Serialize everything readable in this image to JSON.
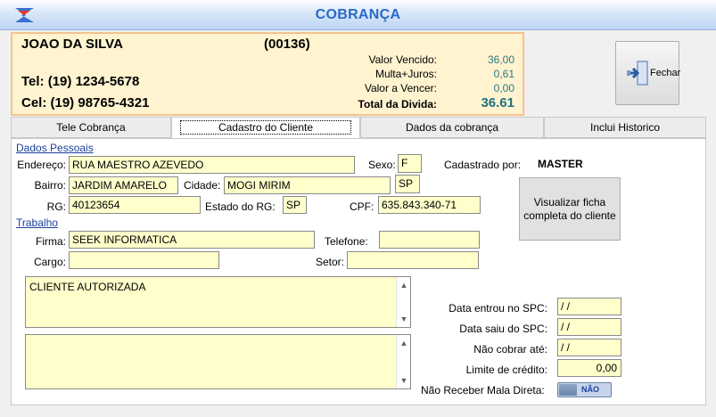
{
  "window": {
    "title": "COBRANÇA"
  },
  "summary": {
    "name": "JOAO DA SILVA",
    "code": "(00136)",
    "tel": "Tel: (19) 1234-5678",
    "cel": "Cel: (19) 98765-4321",
    "valor_vencido_label": "Valor Vencido:",
    "valor_vencido": "36,00",
    "multa_label": "Multa+Juros:",
    "multa": "0,61",
    "a_vencer_label": "Valor a Vencer:",
    "a_vencer": "0,00",
    "total_label": "Total da Divida:",
    "total": "36.61"
  },
  "toolbar": {
    "fechar_label": "Fechar"
  },
  "tabs": [
    {
      "label": "Tele Cobrança"
    },
    {
      "label": "Cadastro do Cliente"
    },
    {
      "label": "Dados da cobrança"
    },
    {
      "label": "Inclui Historico"
    }
  ],
  "dados_pessoais": {
    "section_label": "Dados Pessoais",
    "endereco_label": "Endereço:",
    "endereco": "RUA MAESTRO AZEVEDO",
    "sexo_label": "Sexo:",
    "sexo": "F",
    "cadastrado_label": "Cadastrado por:",
    "cadastrado": "MASTER",
    "bairro_label": "Bairro:",
    "bairro": "JARDIM AMARELO",
    "cidade_label": "Cidade:",
    "cidade": "MOGI MIRIM",
    "uf": "SP",
    "rg_label": "RG:",
    "rg": "40123654",
    "estado_rg_label": "Estado do RG:",
    "estado_rg": "SP",
    "cpf_label": "CPF:",
    "cpf": "635.843.340-71"
  },
  "visualizar_label": "Visualizar ficha completa do cliente",
  "trabalho": {
    "section_label": "Trabalho",
    "firma_label": "Firma:",
    "firma": "SEEK INFORMATICA",
    "telefone_label": "Telefone:",
    "telefone": "",
    "cargo_label": "Cargo:",
    "cargo": "",
    "setor_label": "Setor:",
    "setor": ""
  },
  "memo1": {
    "text": "CLIENTE AUTORIZADA"
  },
  "memo2": {
    "text": ""
  },
  "spc": {
    "entrou_label": "Data entrou no SPC:",
    "entrou": " / /",
    "saiu_label": "Data saiu do SPC:",
    "saiu": " / /",
    "nao_cobrar_label": "Não cobrar até:",
    "nao_cobrar": " / /",
    "limite_label": "Limite de crédito:",
    "limite": "0,00",
    "mala_label": "Não Receber Mala Direta:",
    "mala_value": "NÃO"
  },
  "colors": {
    "title": "#2a69c6",
    "field_bg": "#ffffcc",
    "summary_bg": "#fff3d0",
    "summary_border": "#f5c28e",
    "value_teal": "#2a7a85"
  }
}
